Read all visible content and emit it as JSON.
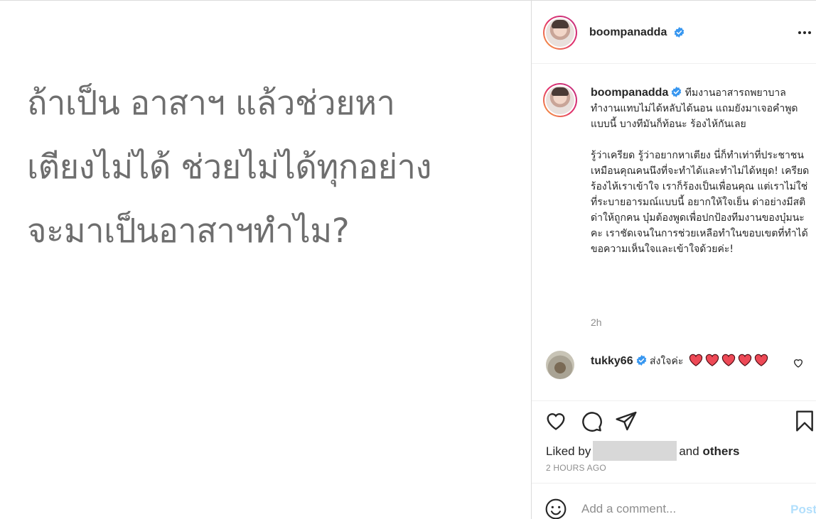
{
  "post_image": {
    "lines": [
      "ถ้าเป็น อาสาฯ แล้วช่วยหา",
      "เตียงไม่ได้ ช่วยไม่ได้ทุกอย่าง",
      "จะมาเป็นอาสาฯทำไม?"
    ]
  },
  "header": {
    "username": "boompanadda",
    "avatar_icon": "profile-photo",
    "more_icon": "more-horizontal-icon"
  },
  "caption": {
    "username": "boompanadda",
    "paragraph1": "ทีมงานอาสารถพยาบาลทำงานแทบไม่ได้หลับได้นอน แถมยังมาเจอคำพูดแบบนี้ บางทีมันก็ท้อนะ ร้องไห้กันเลย",
    "paragraph2": "รู้ว่าเครียด รู้ว่าอยากหาเตียง นี่ก็ทำเท่าที่ประชาชนเหมือนคุณคนนึงที่จะทำได้และทำไม่ได้หยุด! เครียดร้องไห้เราเข้าใจ เราก็ร้องเป็นเพื่อนคุณ แต่เราไม่ใช่ที่ระบายอารมณ์แบบนี้ อยากให้ใจเย็น ด่าอย่างมีสติ ด่าให้ถูกคน บุ๋มต้องพูดเพื่อปกป้องทีมงานของบุ๋มนะคะ เราชัดเจนในการช่วยเหลือทำในขอบเขตที่ทำได้ ขอความเห็นใจและเข้าใจด้วยค่ะ!",
    "timestamp": "2h"
  },
  "comment": {
    "username": "tukky66",
    "text": "ส่งใจค่ะ",
    "emoji": "red-heart",
    "emoji_count": 5
  },
  "likes": {
    "prefix": "Liked by",
    "connector": "and",
    "others": "others"
  },
  "post_time": "2 HOURS AGO",
  "add_comment": {
    "placeholder": "Add a comment...",
    "post_label": "Post"
  },
  "colors": {
    "verified": "#3897f0",
    "heart": "#ed4956",
    "post_disabled": "#b2dffc",
    "muted": "#8e8e8e",
    "image_text": "#6e6e6e"
  }
}
